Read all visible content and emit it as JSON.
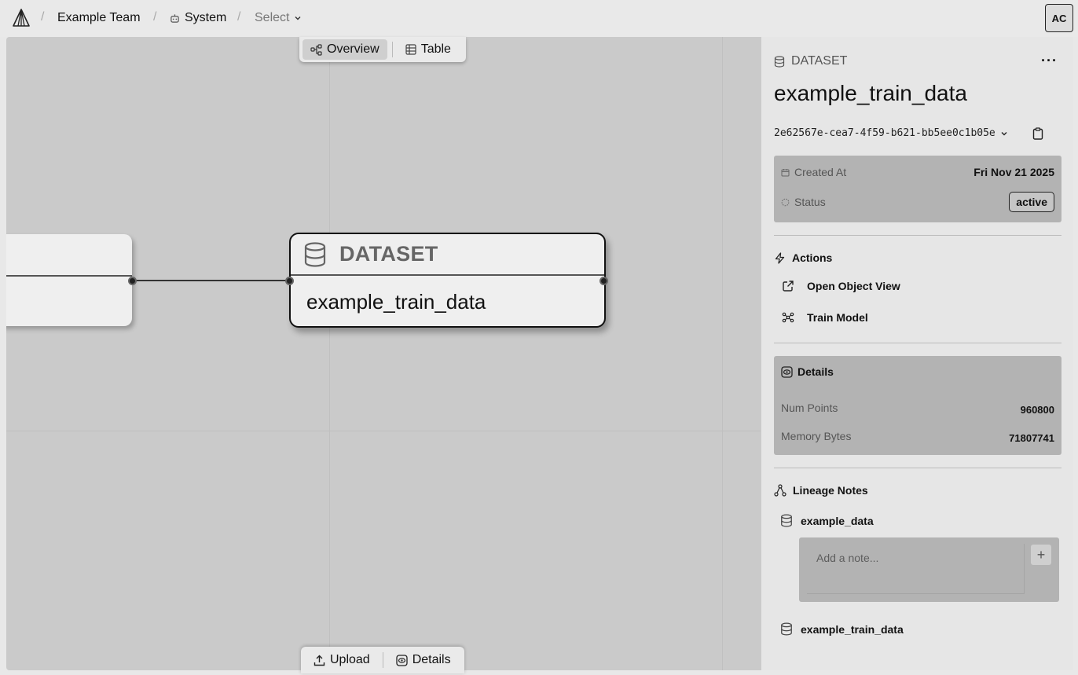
{
  "breadcrumb": {
    "team": "Example Team",
    "system": "System",
    "select": "Select",
    "separator": "/"
  },
  "user": {
    "initials": "AC"
  },
  "view_toggle": {
    "overview": "Overview",
    "table": "Table"
  },
  "bottom_toolbar": {
    "upload": "Upload",
    "details": "Details"
  },
  "node": {
    "type": "DATASET",
    "name": "example_train_data"
  },
  "panel": {
    "type_label": "DATASET",
    "more": "···",
    "title": "example_train_data",
    "id": "2e62567e-cea7-4f59-b621-bb5ee0c1b05e",
    "meta": {
      "created_label": "Created At",
      "created_value": "Fri Nov 21 2025",
      "status_label": "Status",
      "status_value": "active"
    },
    "actions": {
      "title": "Actions",
      "open_object_view": "Open Object View",
      "train_model": "Train Model"
    },
    "details": {
      "title": "Details",
      "num_points_label": "Num Points",
      "num_points_value": "960800",
      "memory_bytes_label": "Memory Bytes",
      "memory_bytes_value": "71807741"
    },
    "lineage": {
      "title": "Lineage Notes",
      "parent": "example_data",
      "note_placeholder": "Add a note...",
      "add": "+",
      "child": "example_train_data"
    }
  }
}
